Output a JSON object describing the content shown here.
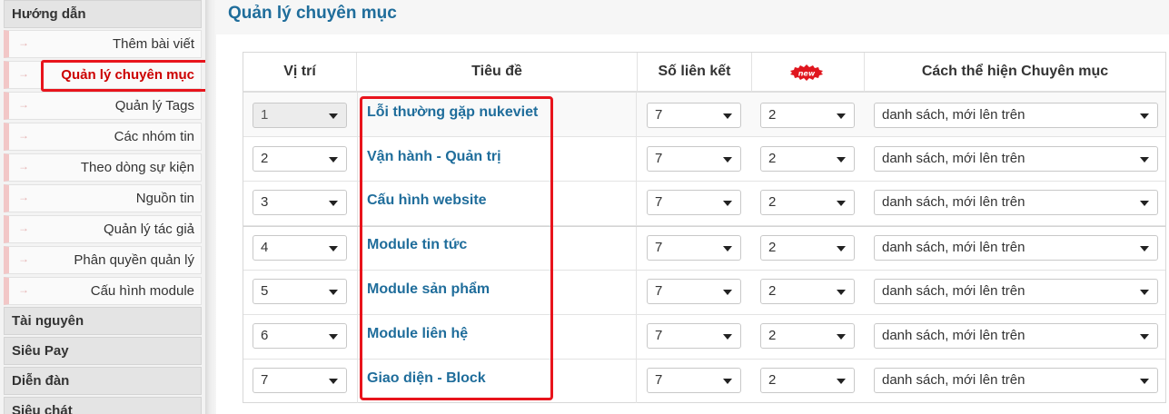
{
  "sidebar": {
    "groups_top": {
      "guide": "Hướng dẫn"
    },
    "items": [
      {
        "label": "Thêm bài viết",
        "active": false
      },
      {
        "label": "Quản lý chuyên mục",
        "active": true
      },
      {
        "label": "Quản lý Tags",
        "active": false
      },
      {
        "label": "Các nhóm tin",
        "active": false
      },
      {
        "label": "Theo dòng sự kiện",
        "active": false
      },
      {
        "label": "Nguồn tin",
        "active": false
      },
      {
        "label": "Quản lý tác giả",
        "active": false
      },
      {
        "label": "Phân quyền quản lý",
        "active": false
      },
      {
        "label": "Cấu hình module",
        "active": false
      }
    ],
    "groups_bottom": [
      "Tài nguyên",
      "Siêu Pay",
      "Diễn đàn",
      "Siêu chát"
    ],
    "arrow_glyph": "→"
  },
  "main": {
    "title": "Quản lý chuyên mục",
    "table": {
      "headers": {
        "position": "Vị trí",
        "title": "Tiêu đề",
        "num_links": "Số liên kết",
        "new_badge_icon": "new-badge-icon",
        "display_style": "Cách thể hiện Chuyên mục"
      },
      "rows": [
        {
          "position": "1",
          "position_disabled": true,
          "title": "Lỗi thường gặp nukeviet",
          "num_links": "7",
          "new_count": "2",
          "display": "danh sách, mới lên trên"
        },
        {
          "position": "2",
          "position_disabled": false,
          "title": "Vận hành - Quản trị",
          "num_links": "7",
          "new_count": "2",
          "display": "danh sách, mới lên trên"
        },
        {
          "position": "3",
          "position_disabled": false,
          "title": "Cấu hình website",
          "num_links": "7",
          "new_count": "2",
          "display": "danh sách, mới lên trên"
        },
        {
          "position": "4",
          "position_disabled": false,
          "title": "Module tin tức",
          "num_links": "7",
          "new_count": "2",
          "display": "danh sách, mới lên trên"
        },
        {
          "position": "5",
          "position_disabled": false,
          "title": "Module sản phẩm",
          "num_links": "7",
          "new_count": "2",
          "display": "danh sách, mới lên trên"
        },
        {
          "position": "6",
          "position_disabled": false,
          "title": "Module liên hệ",
          "num_links": "7",
          "new_count": "2",
          "display": "danh sách, mới lên trên"
        },
        {
          "position": "7",
          "position_disabled": false,
          "title": "Giao diện - Block",
          "num_links": "7",
          "new_count": "2",
          "display": "danh sách, mới lên trên"
        }
      ]
    }
  },
  "colors": {
    "accent_link": "#1f6d9b",
    "highlight_red": "#e8141c",
    "active_item_text": "#cc0000",
    "new_badge_red": "#e0161e"
  }
}
